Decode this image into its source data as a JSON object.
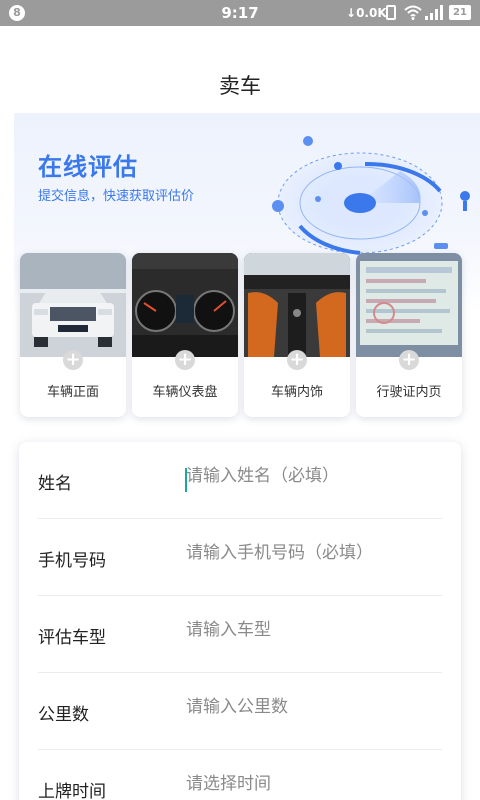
{
  "status_bar": {
    "notification_count": "8",
    "time": "9:17",
    "net_speed": "0.0K",
    "battery_level": "21"
  },
  "header": {
    "title": "卖车"
  },
  "banner": {
    "title": "在线评估",
    "subtitle": "提交信息，快速获取评估价",
    "accent_color": "#3a78ec"
  },
  "photo_cards": [
    {
      "label": "车辆正面",
      "icon": "car-front-photo"
    },
    {
      "label": "车辆仪表盘",
      "icon": "dashboard-photo"
    },
    {
      "label": "车辆内饰",
      "icon": "interior-photo"
    },
    {
      "label": "行驶证内页",
      "icon": "license-photo"
    }
  ],
  "form": {
    "rows": [
      {
        "label": "姓名",
        "placeholder": "请输入姓名（必填）",
        "value": ""
      },
      {
        "label": "手机号码",
        "placeholder": "请输入手机号码（必填）",
        "value": ""
      },
      {
        "label": "评估车型",
        "placeholder": "请输入车型",
        "value": ""
      },
      {
        "label": "公里数",
        "placeholder": "请输入公里数",
        "value": ""
      },
      {
        "label": "上牌时间",
        "placeholder": "请选择时间",
        "value": ""
      }
    ]
  }
}
